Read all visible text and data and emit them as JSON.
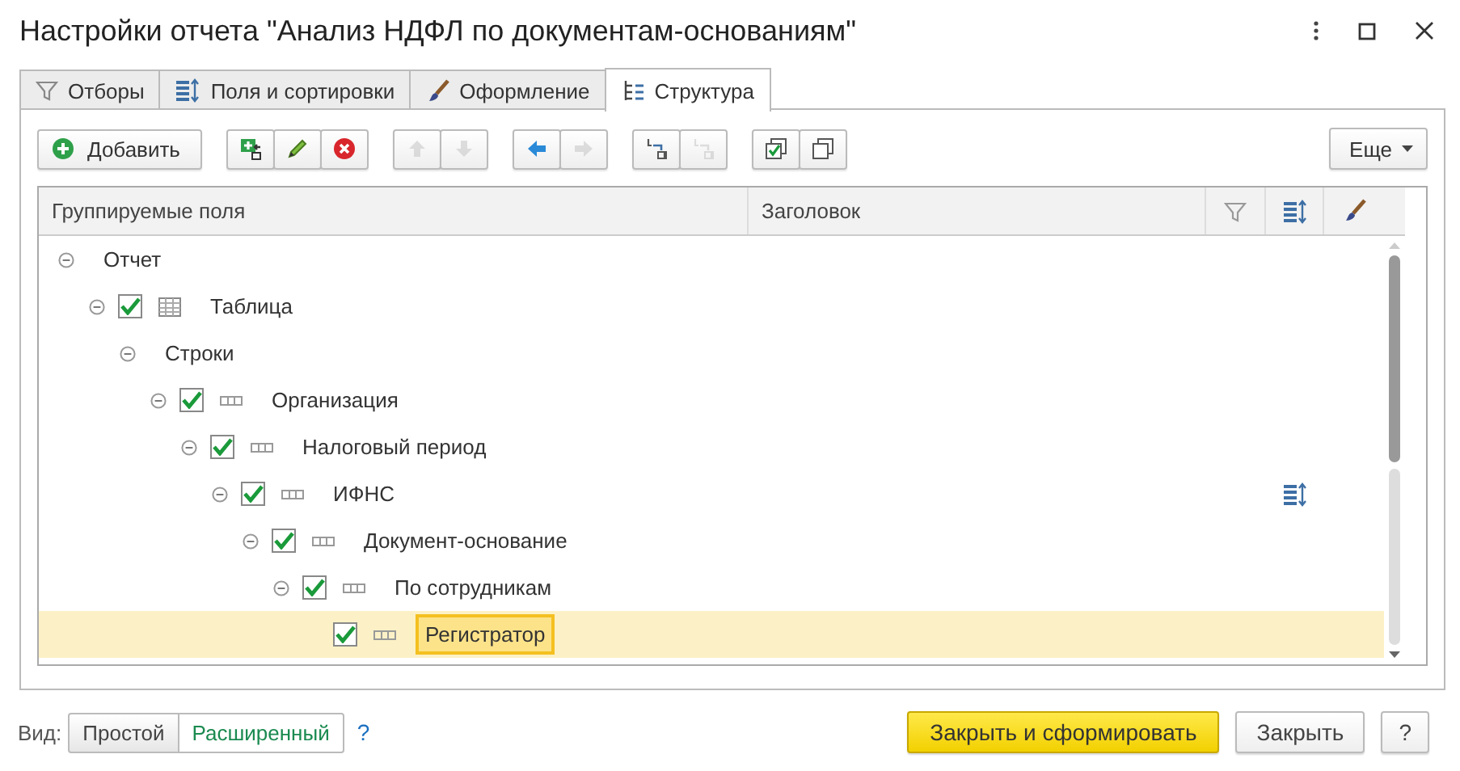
{
  "window": {
    "title": "Настройки отчета \"Анализ НДФЛ по документам-основаниям\""
  },
  "tabs": [
    {
      "label": "Отборы",
      "selected": false
    },
    {
      "label": "Поля и сортировки",
      "selected": false
    },
    {
      "label": "Оформление",
      "selected": false
    },
    {
      "label": "Структура",
      "selected": true
    }
  ],
  "toolbar": {
    "buttons": [
      {
        "kind": "add",
        "label": "Добавить",
        "disabled": false
      },
      {
        "kind": "add-group",
        "disabled": false
      },
      {
        "kind": "edit",
        "disabled": false
      },
      {
        "kind": "delete",
        "disabled": false
      },
      {
        "kind": "up",
        "disabled": true
      },
      {
        "kind": "down",
        "disabled": true
      },
      {
        "kind": "left",
        "disabled": false
      },
      {
        "kind": "right",
        "disabled": true
      },
      {
        "kind": "group",
        "disabled": false
      },
      {
        "kind": "ungroup",
        "disabled": true
      },
      {
        "kind": "check-all",
        "disabled": false
      },
      {
        "kind": "uncheck-all",
        "disabled": false
      }
    ],
    "more": {
      "label": "Еще"
    }
  },
  "table": {
    "columns": [
      {
        "kind": "text",
        "label": "Группируемые поля"
      },
      {
        "kind": "text",
        "label": "Заголовок"
      },
      {
        "kind": "filter"
      },
      {
        "kind": "sort"
      },
      {
        "kind": "brush"
      }
    ],
    "tree": [
      {
        "label": "Отчет",
        "expanded": true,
        "selected": false,
        "children": [
          {
            "label": "Таблица",
            "kind": "table",
            "checked": true,
            "expanded": true,
            "selected": false,
            "children": [
              {
                "label": "Строки",
                "expanded": true,
                "selected": false,
                "children": [
                  {
                    "label": "Организация",
                    "kind": "field",
                    "checked": true,
                    "expanded": true,
                    "selected": false,
                    "children": [
                      {
                        "label": "Налоговый период",
                        "kind": "field",
                        "checked": true,
                        "expanded": true,
                        "selected": false,
                        "children": [
                          {
                            "label": "ИФНС",
                            "kind": "field",
                            "checked": true,
                            "expanded": true,
                            "selected": false,
                            "sorted": true,
                            "children": [
                              {
                                "label": "Документ-основание",
                                "kind": "field",
                                "checked": true,
                                "expanded": true,
                                "selected": false,
                                "children": [
                                  {
                                    "label": "По сотрудникам",
                                    "kind": "field",
                                    "checked": true,
                                    "expanded": true,
                                    "selected": false,
                                    "children": [
                                      {
                                        "label": "Регистратор",
                                        "kind": "field",
                                        "checked": true,
                                        "selected": true
                                      }
                                    ]
                                  }
                                ]
                              }
                            ]
                          }
                        ]
                      }
                    ]
                  }
                ]
              }
            ]
          }
        ]
      }
    ]
  },
  "footer": {
    "view_label": "Вид:",
    "view_options": [
      {
        "label": "Простой",
        "selected": false
      },
      {
        "label": "Расширенный",
        "selected": true
      }
    ],
    "help_link": "?",
    "buttons": [
      {
        "kind": "primary",
        "label": "Закрыть и сформировать"
      },
      {
        "kind": "normal",
        "label": "Закрыть"
      },
      {
        "kind": "normal",
        "label": "?"
      }
    ]
  }
}
